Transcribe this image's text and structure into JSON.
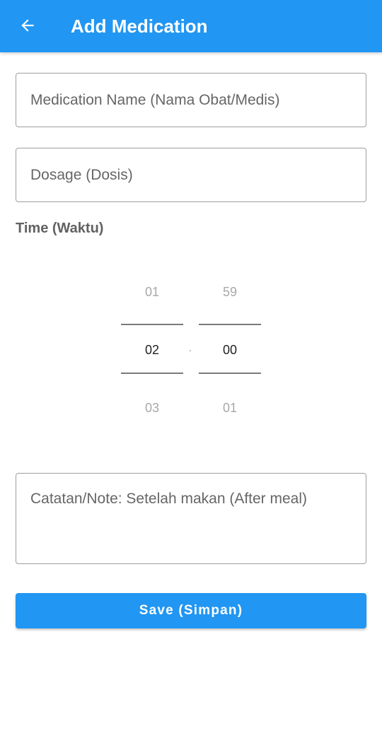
{
  "appbar": {
    "title": "Add Medication",
    "back_icon": "arrow-left-icon"
  },
  "form": {
    "medication_name": {
      "value": "",
      "placeholder": "Medication Name (Nama Obat/Medis)"
    },
    "dosage": {
      "value": "",
      "placeholder": "Dosage (Dosis)"
    },
    "time_label": "Time (Waktu)",
    "time_picker": {
      "hour": {
        "prev": "01",
        "selected": "02",
        "next": "03"
      },
      "separator": ".",
      "minute": {
        "prev": "59",
        "selected": "00",
        "next": "01"
      }
    },
    "note": {
      "value": "",
      "placeholder": "Catatan/Note: Setelah makan (After meal)"
    },
    "save_label": "Save (Simpan)"
  },
  "colors": {
    "primary": "#2196f3",
    "border": "#9e9e9e",
    "label": "#616161"
  }
}
